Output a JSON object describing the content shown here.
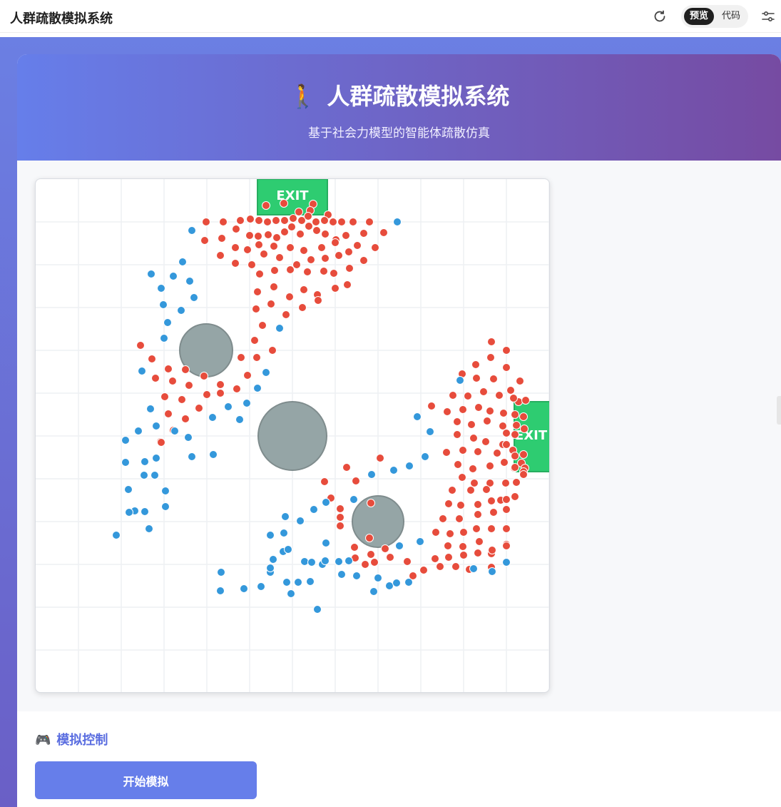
{
  "topbar": {
    "title": "人群疏散模拟系统",
    "refresh_icon": "refresh-icon",
    "view_toggle": {
      "preview": "预览",
      "code": "代码",
      "active": "preview"
    },
    "settings_icon": "settings-sliders-icon"
  },
  "hero": {
    "emoji": "🚶",
    "title": "人群疏散模拟系统",
    "subtitle": "基于社会力模型的智能体疏散仿真"
  },
  "simulation": {
    "colors": {
      "exit": "#2ecc71",
      "exit_border": "#27ae60",
      "obstacle": "#95a5a6",
      "obstacle_border": "#7f8c8d",
      "agent_red": "#e74c3c",
      "agent_blue": "#3498db",
      "grid": "#eef0f3"
    },
    "exits": [
      {
        "label": "EXIT",
        "side": "top"
      },
      {
        "label": "EXIT",
        "side": "right"
      }
    ],
    "obstacle_count": 3
  },
  "controls": {
    "emoji": "🎮",
    "heading": "模拟控制",
    "start_button": "开始模拟"
  }
}
